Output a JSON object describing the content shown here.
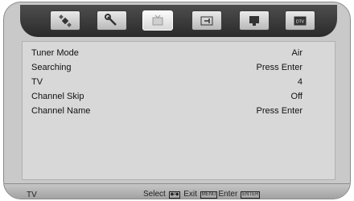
{
  "tabs": [
    {
      "icon": "satellite-icon",
      "active": false
    },
    {
      "icon": "wrench-icon",
      "active": false
    },
    {
      "icon": "tv-icon",
      "active": true
    },
    {
      "icon": "audio-icon",
      "active": false
    },
    {
      "icon": "monitor-icon",
      "active": false
    },
    {
      "icon": "dtv-icon",
      "active": false,
      "label": "DTV"
    }
  ],
  "menu": {
    "items": [
      {
        "label": "Tuner Mode",
        "value": "Air"
      },
      {
        "label": "Searching",
        "value": "Press Enter"
      },
      {
        "label": "TV",
        "value": "4"
      },
      {
        "label": "Channel Skip",
        "value": "Off"
      },
      {
        "label": "Channel Name",
        "value": "Press Enter"
      }
    ]
  },
  "footer": {
    "source": "TV",
    "select_label": "Select",
    "select_key": "◆/◆",
    "exit_label": "Exit",
    "exit_key": "MENU",
    "enter_label": "Enter",
    "enter_key": "ENTER"
  },
  "colors": {
    "bezel": "#c9c9c9",
    "topbar": "#3a3a3a",
    "panel": "#d8d8d8"
  }
}
